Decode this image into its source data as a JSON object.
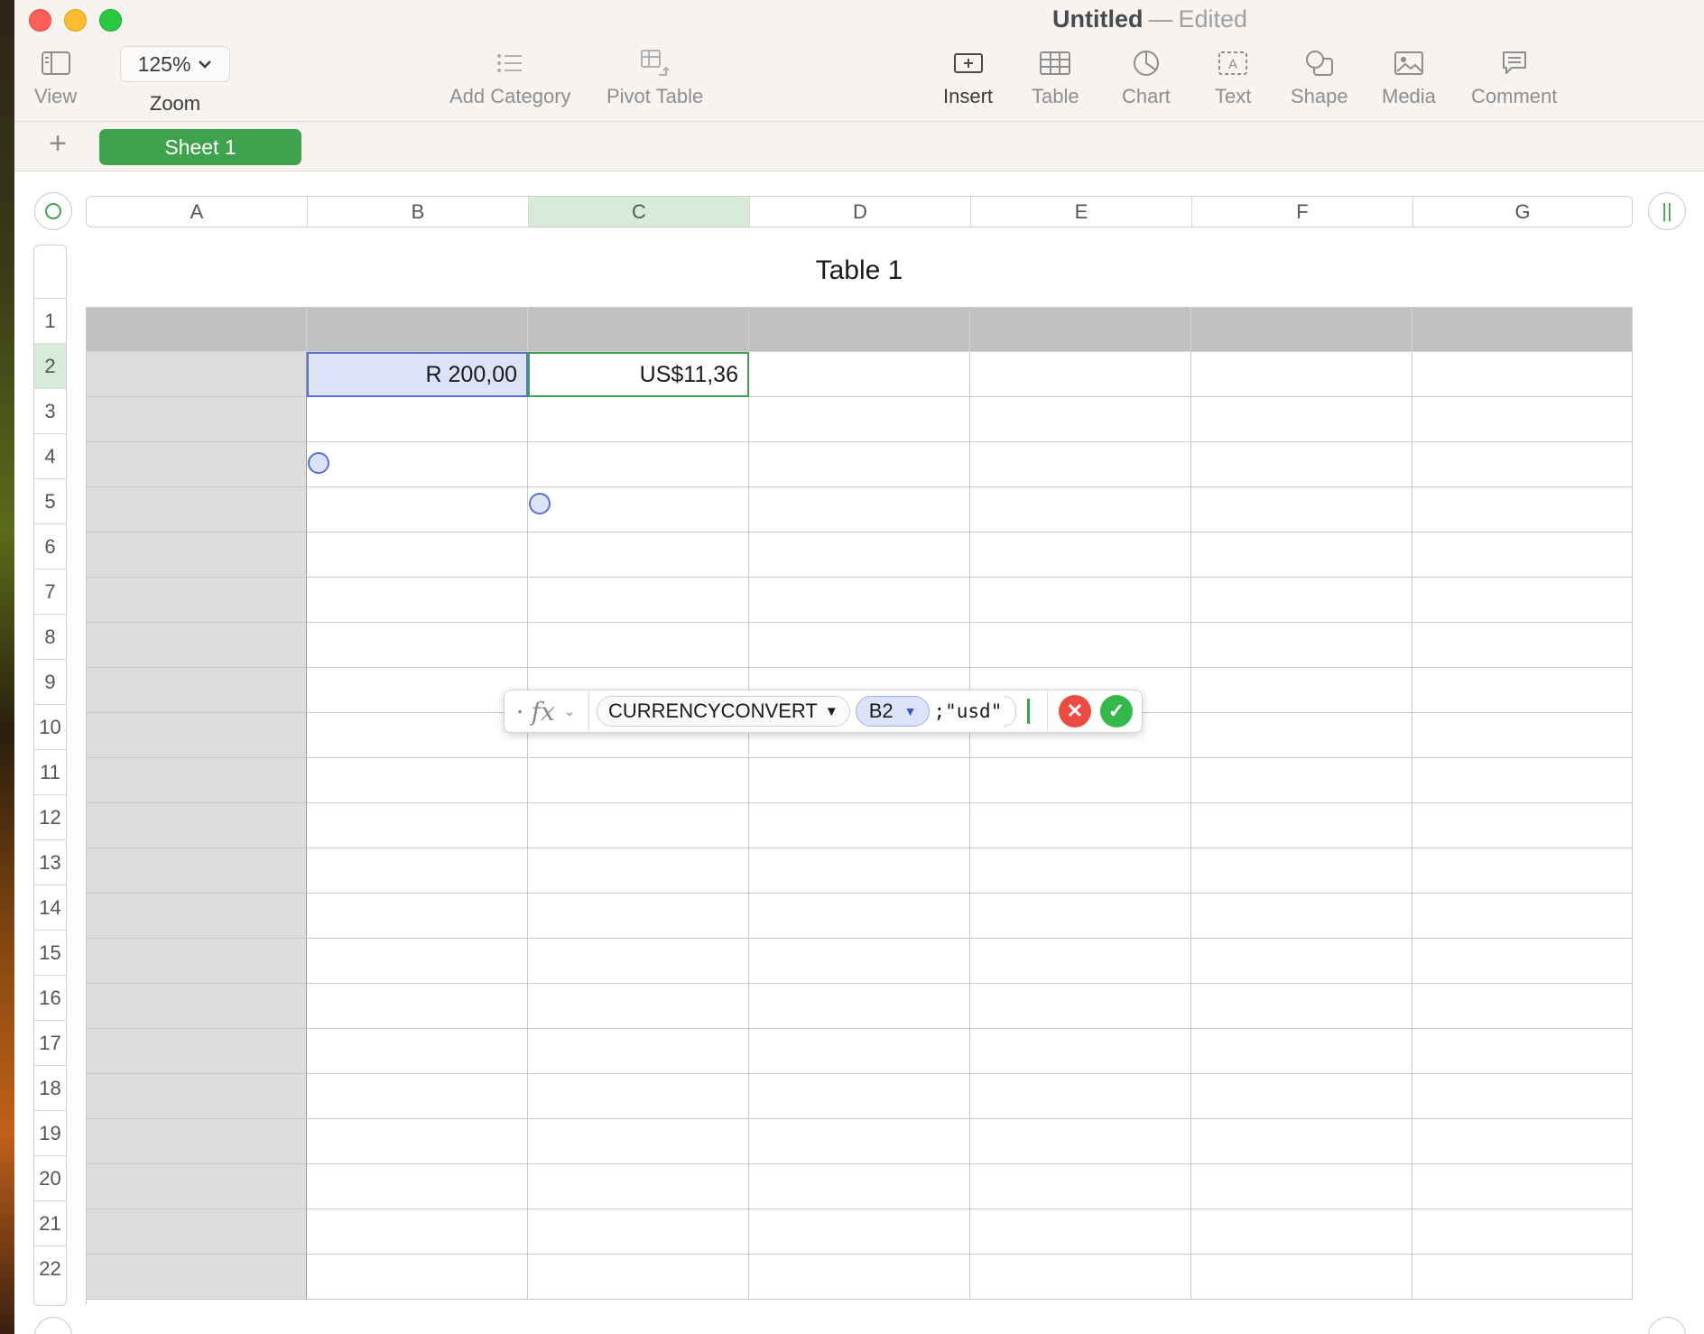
{
  "window": {
    "title": "Untitled",
    "separator": "—",
    "status": "Edited"
  },
  "toolbar": {
    "view_label": "View",
    "zoom_value": "125%",
    "zoom_label": "Zoom",
    "add_category_label": "Add Category",
    "pivot_table_label": "Pivot Table",
    "insert_label": "Insert",
    "table_label": "Table",
    "chart_label": "Chart",
    "text_label": "Text",
    "shape_label": "Shape",
    "media_label": "Media",
    "comment_label": "Comment"
  },
  "sheets": {
    "add_symbol": "+",
    "active_tab": "Sheet 1"
  },
  "grid": {
    "columns": [
      "A",
      "B",
      "C",
      "D",
      "E",
      "F",
      "G"
    ],
    "rows": [
      "1",
      "2",
      "3",
      "4",
      "5",
      "6",
      "7",
      "8",
      "9",
      "10",
      "11",
      "12",
      "13",
      "14",
      "15",
      "16",
      "17",
      "18",
      "19",
      "20",
      "21",
      "22"
    ],
    "selected_column": "C",
    "selected_row": "2",
    "table_title": "Table 1",
    "cells": {
      "B2": "R 200,00",
      "C2": "US$11,36"
    }
  },
  "formula": {
    "function_name": "CURRENCYCONVERT",
    "reference": "B2",
    "argument": ";\"usd\""
  },
  "colors": {
    "accent_green": "#3fa34d",
    "selection_blue": "#5a6fd2",
    "cancel_red": "#ea4b43"
  }
}
